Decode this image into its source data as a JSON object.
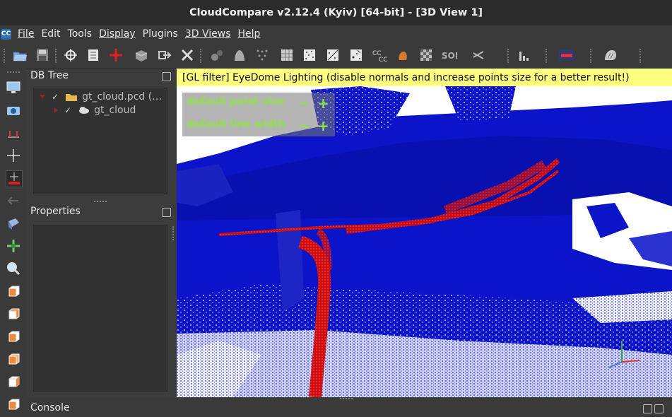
{
  "window": {
    "title": "CloudCompare v2.12.4 (Kyiv) [64-bit] - [3D View 1]"
  },
  "menu": {
    "app_icon": "CC",
    "items": [
      {
        "label": "File"
      },
      {
        "label": "Edit"
      },
      {
        "label": "Tools"
      },
      {
        "label": "Display"
      },
      {
        "label": "Plugins"
      },
      {
        "label": "3D Views"
      },
      {
        "label": "Help"
      }
    ]
  },
  "toolbar": {
    "icons": [
      "open-folder-icon",
      "save-icon",
      "pick-rotation-center-icon",
      "list-icon",
      "translate-rotate-icon",
      "segment-icon",
      "export-icon",
      "delete-icon",
      "sample-points-icon",
      "smooth-icon",
      "subsample-icon",
      "mesh-icon",
      "noise-icon",
      "normal-icon",
      "point-size-icon",
      "cloud-cloud-distance-icon",
      "cc-icon",
      "cloud-mesh-distance-icon",
      "checkerboard-icon",
      "sor-filter-icon",
      "scissors-icon",
      "histogram-icon",
      "ramp-icon",
      "plugin-icon"
    ],
    "labels": {
      "sor": "SOR",
      "cc": "CC"
    }
  },
  "db_tree": {
    "title": "DB Tree",
    "rows": [
      {
        "label": "gt_cloud.pcd (…"
      },
      {
        "label": "gt_cloud"
      }
    ]
  },
  "properties": {
    "title": "Properties"
  },
  "console": {
    "title": "Console"
  },
  "view3d": {
    "gl_filter_message": "[GL filter] EyeDome Lighting (disable normals and increase points size for a better result!)",
    "overlay": {
      "point_size_label": "default point size",
      "line_width_label": "default line width",
      "minus": "−",
      "plus": "+"
    }
  },
  "colors": {
    "accent": "#8fe04a",
    "banner": "#fdfd80",
    "cloud_blue": "#0b14c8",
    "trajectory_red": "#e01414"
  }
}
